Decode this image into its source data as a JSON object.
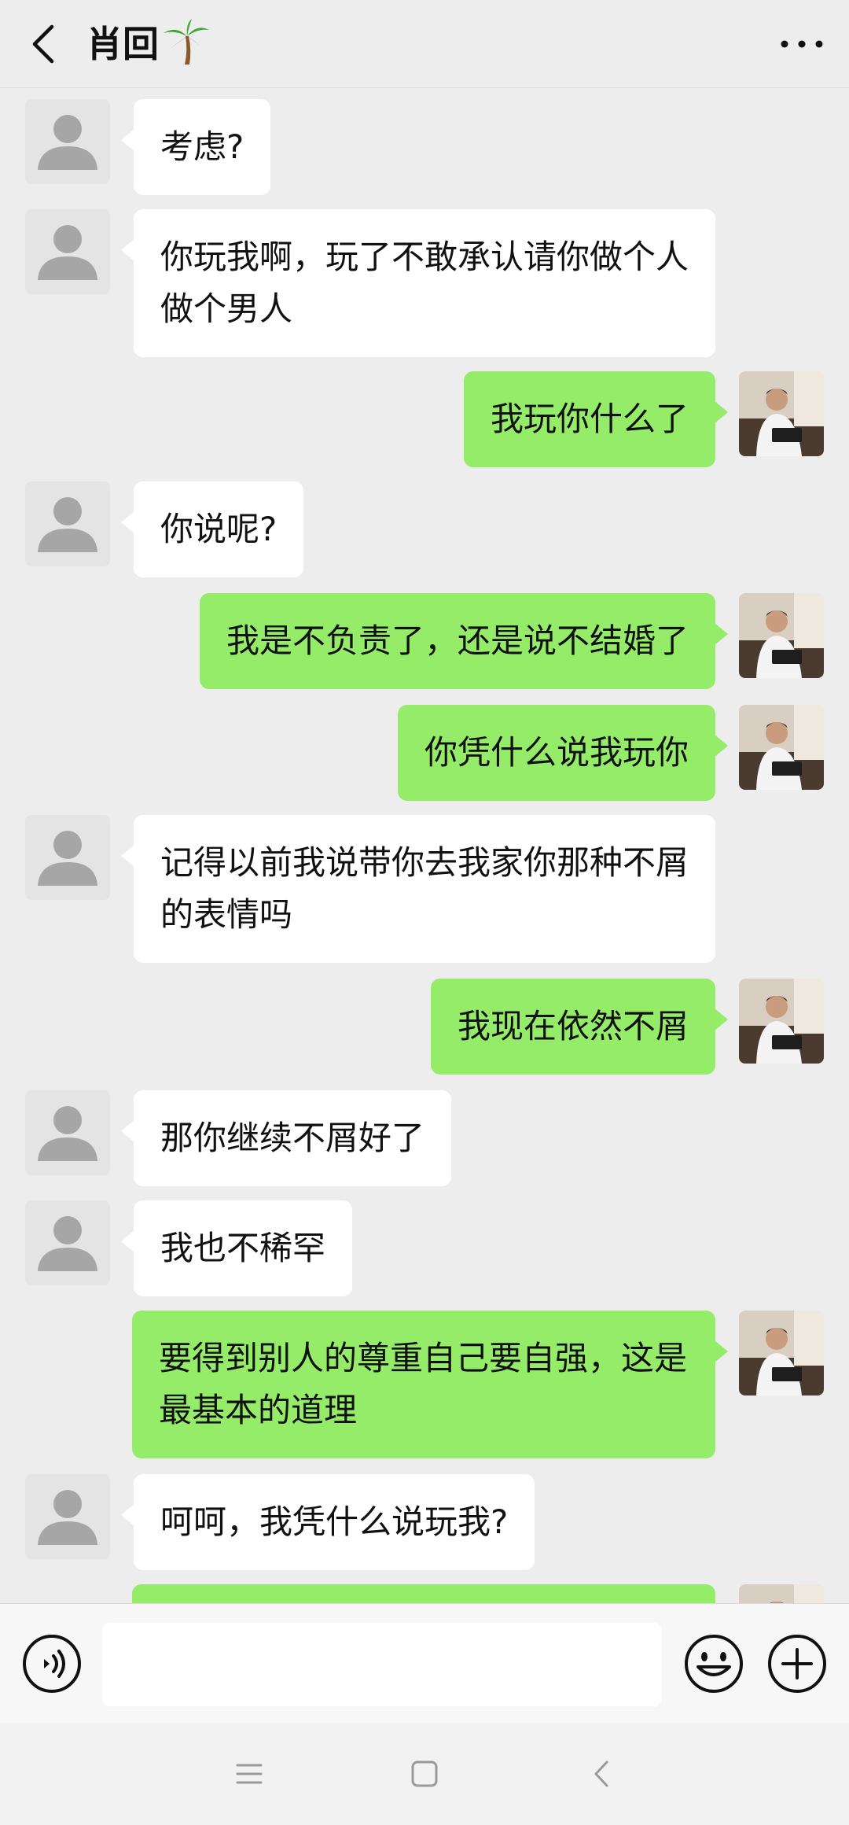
{
  "header": {
    "title": "肖回",
    "back_icon": "chevron-left-icon",
    "title_emoji_icon": "palm-tree-icon",
    "more_icon": "ellipsis-icon"
  },
  "colors": {
    "background": "#ededed",
    "sent_bubble": "#95ec69",
    "received_bubble": "#ffffff"
  },
  "messages": [
    {
      "side": "left",
      "text": "考虑?"
    },
    {
      "side": "left",
      "text": "你玩我啊，玩了不敢承认请你做个人做个男人"
    },
    {
      "side": "right",
      "text": "我玩你什么了"
    },
    {
      "side": "left",
      "text": "你说呢?"
    },
    {
      "side": "right",
      "text": "我是不负责了，还是说不结婚了"
    },
    {
      "side": "right",
      "text": "你凭什么说我玩你"
    },
    {
      "side": "left",
      "text": "记得以前我说带你去我家你那种不屑的表情吗"
    },
    {
      "side": "right",
      "text": "我现在依然不屑"
    },
    {
      "side": "left",
      "text": "那你继续不屑好了"
    },
    {
      "side": "left",
      "text": "我也不稀罕"
    },
    {
      "side": "right",
      "text": "要得到别人的尊重自己要自强，这是最基本的道理"
    },
    {
      "side": "left",
      "text": "呵呵，我凭什么说玩我?"
    },
    {
      "side": "right",
      "text": ""
    }
  ],
  "input_bar": {
    "voice_icon": "voice-icon",
    "text_value": "",
    "emoji_icon": "smiley-icon",
    "plus_icon": "plus-circle-icon"
  },
  "system_nav": {
    "menu_icon": "menu-icon",
    "home_icon": "home-square-icon",
    "back_icon": "back-arrow-icon"
  }
}
